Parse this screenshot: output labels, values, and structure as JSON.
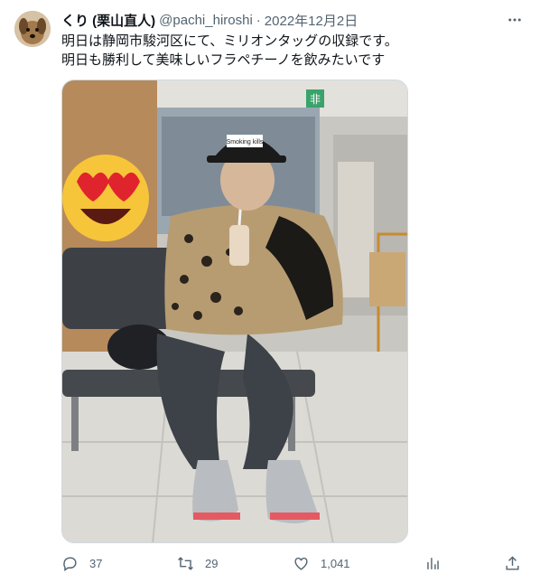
{
  "tweet": {
    "display_name": "くり (栗山直人)",
    "handle": "@pachi_hiroshi",
    "separator": "·",
    "date": "2022年12月2日",
    "text_lines": [
      "明日は静岡市駿河区にて、ミリオンタッグの収録です。",
      "明日も勝利して美味しいフラペチーノを飲みたいです"
    ]
  },
  "media": {
    "cap_text": "Smoking kills",
    "exit_sign": "非"
  },
  "actions": {
    "reply_count": "37",
    "retweet_count": "29",
    "like_count": "1,041"
  },
  "icons": {
    "avatar": "dog-photo",
    "more": "more-dots-icon",
    "reply": "reply-icon",
    "retweet": "retweet-icon",
    "like": "heart-icon",
    "views": "bar-chart-icon",
    "share": "share-icon"
  }
}
